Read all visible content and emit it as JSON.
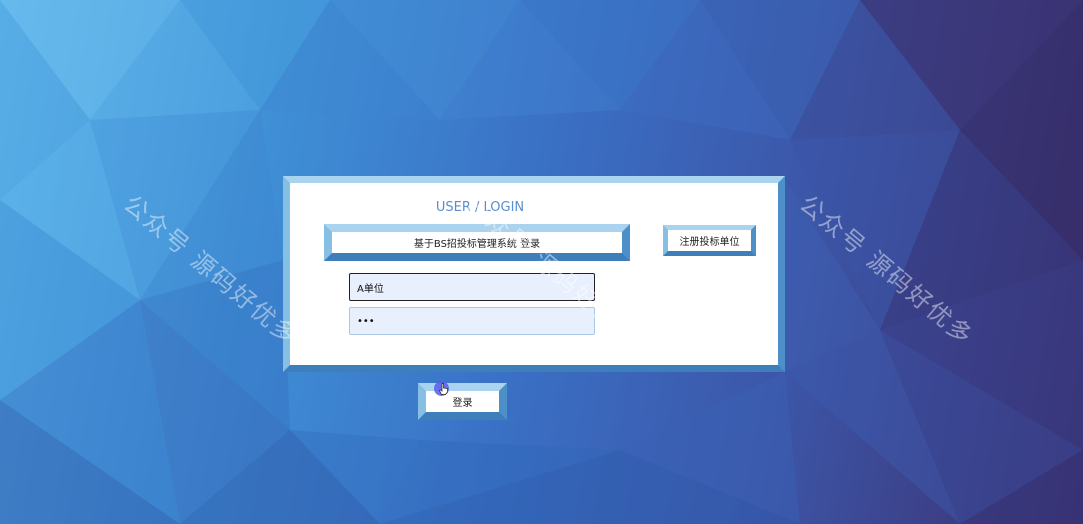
{
  "login": {
    "title": "USER / LOGIN",
    "system_name": "基于BS招投标管理系统 登录",
    "register_label": "注册投标单位",
    "username_value": "A单位",
    "password_value": "•••",
    "submit_label": "登录"
  },
  "watermark": {
    "text": "公众号 源码好优多"
  },
  "colors": {
    "panel_border_light": "#a9d3ee",
    "panel_border_dark": "#3e7fbb",
    "title_text": "#5a8fcc",
    "input_bg": "#e8effd",
    "cursor_highlight": "#5a5aeb"
  },
  "icons": {
    "cursor": "hand-pointer-icon"
  }
}
